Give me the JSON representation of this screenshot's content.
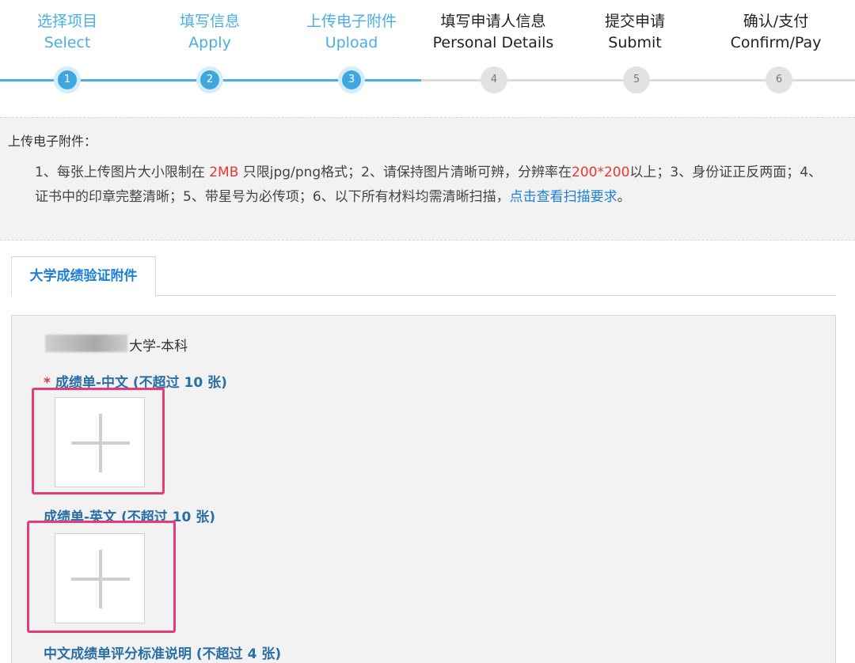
{
  "steps": [
    {
      "num": "1",
      "cn": "选择项目",
      "en": "Select",
      "state": "done"
    },
    {
      "num": "2",
      "cn": "填写信息",
      "en": "Apply",
      "state": "done"
    },
    {
      "num": "3",
      "cn": "上传电子附件",
      "en": "Upload",
      "state": "done"
    },
    {
      "num": "4",
      "cn": "填写申请人信息",
      "en": "Personal Details",
      "state": "todo"
    },
    {
      "num": "5",
      "cn": "提交申请",
      "en": "Submit",
      "state": "todo"
    },
    {
      "num": "6",
      "cn": "确认/支付",
      "en": "Confirm/Pay",
      "state": "todo"
    }
  ],
  "notice": {
    "title": "上传电子附件：",
    "p1": "1、每张上传图片大小限制在 ",
    "size_limit": "2MB",
    "p2": " 只限jpg/png格式；2、请保持图片清晰可辨，分辨率在",
    "resolution": "200*200",
    "p3": "以上；3、身份证正反两面；4、证书中的印章完整清晰；5、带星号为必传项；6、以下所有材料均需清晰扫描，",
    "link": "点击查看扫描要求",
    "p4": "。"
  },
  "tabs": [
    {
      "label": "大学成绩验证附件"
    }
  ],
  "panel": {
    "university": "大学-本科",
    "required_mark": "*",
    "fields": [
      {
        "label": "成绩单-中文 (不超过 10 张)",
        "required": true
      },
      {
        "label": "成绩单-英文 (不超过 10 张)",
        "required": false
      },
      {
        "label": "中文成绩单评分标准说明 (不超过 4 张)",
        "required": false
      }
    ]
  },
  "colors": {
    "accent": "#4aaee3",
    "link": "#1d7fd6",
    "warning": "#e53935",
    "highlight": "#e63b7a",
    "field_label": "#2a6ea6"
  },
  "icons": {
    "upload_add": "plus-icon"
  }
}
